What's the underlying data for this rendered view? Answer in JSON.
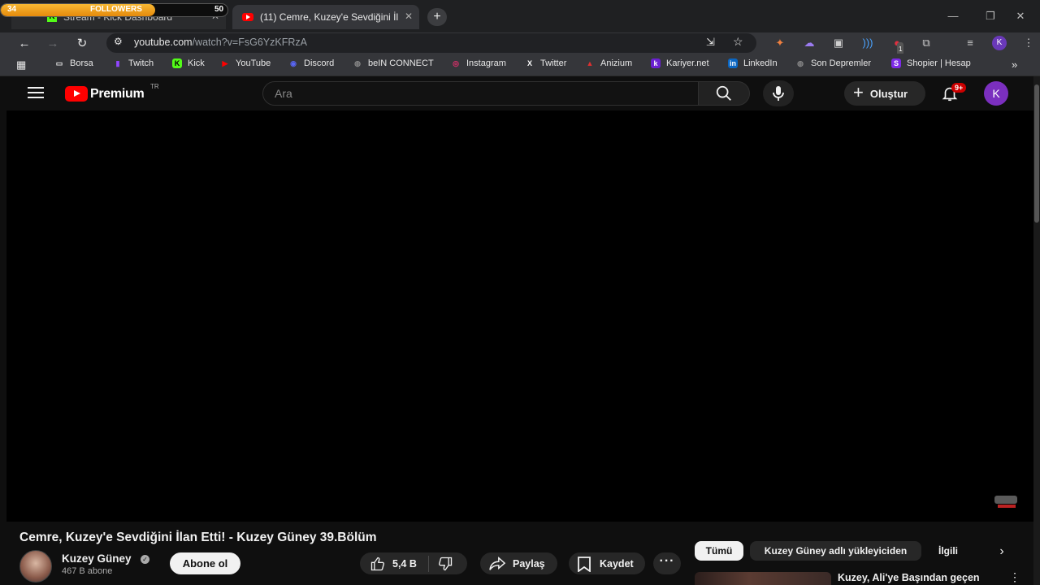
{
  "overlay": {
    "label": "FOLLOWERS",
    "current": "34",
    "goal": "50",
    "progress": 0.68
  },
  "tabs": [
    {
      "title": "Stream - Kick Dashboard"
    },
    {
      "title": "(11) Cemre, Kuzey'e Sevdiğini İl"
    }
  ],
  "toolbar": {
    "url_host": "youtube.com",
    "url_path": "/watch?v=FsG6YzKFRzA",
    "profile_initial": "K",
    "extension_badge": "1"
  },
  "bookmarks": [
    {
      "label": "Borsa",
      "icon": "folder-icon",
      "color": "#e8e8e8"
    },
    {
      "label": "Twitch",
      "icon": "twitch-icon",
      "color": "#9146ff"
    },
    {
      "label": "Kick",
      "icon": "kick-icon",
      "color": "#53fc18"
    },
    {
      "label": "YouTube",
      "icon": "youtube-icon",
      "color": "#ff0000"
    },
    {
      "label": "Discord",
      "icon": "discord-icon",
      "color": "#5865f2"
    },
    {
      "label": "beIN CONNECT",
      "icon": "globe-icon",
      "color": "#888888"
    },
    {
      "label": "Instagram",
      "icon": "instagram-icon",
      "color": "#e1306c"
    },
    {
      "label": "Twitter",
      "icon": "x-icon",
      "color": "#ffffff"
    },
    {
      "label": "Anizium",
      "icon": "anizium-icon",
      "color": "#e03030"
    },
    {
      "label": "Kariyer.net",
      "icon": "kariyer-icon",
      "color": "#6a1fd1"
    },
    {
      "label": "LinkedIn",
      "icon": "linkedin-icon",
      "color": "#0a66c2"
    },
    {
      "label": "Son Depremler",
      "icon": "globe-icon",
      "color": "#888888"
    },
    {
      "label": "Shopier | Hesap",
      "icon": "shopier-icon",
      "color": "#7d2ae8"
    }
  ],
  "youtube": {
    "logo": "Premium",
    "region": "TR",
    "search_placeholder": "Ara",
    "create_label": "Oluştur",
    "notification_badge": "9+",
    "avatar_initial": "K",
    "video": {
      "title": "Cemre, Kuzey'e Sevdiğini İlan Etti! - Kuzey Güney 39.Bölüm",
      "channel": "Kuzey Güney",
      "subscribers": "467 B abone",
      "subscribe_label": "Abone ol",
      "likes": "5,4 B",
      "share_label": "Paylaş",
      "save_label": "Kaydet"
    },
    "chips": [
      "Tümü",
      "Kuzey Güney adlı yükleyiciden",
      "İlgili"
    ],
    "recommendation": {
      "title": "Kuzey, Ali'ye Başından geçen"
    }
  }
}
